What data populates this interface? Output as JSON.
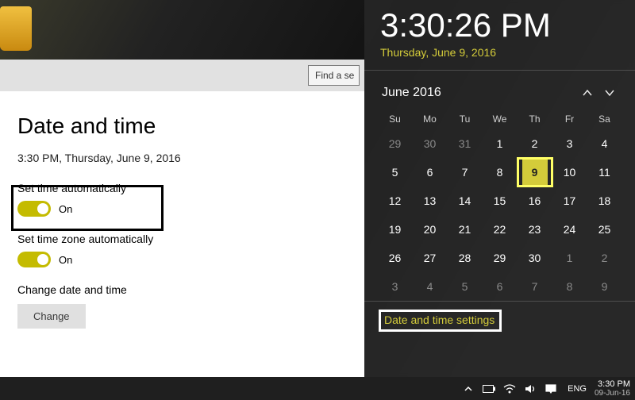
{
  "ribbon": {
    "search_placeholder": "Find a se"
  },
  "settings": {
    "title": "Date and time",
    "current": "3:30 PM, Thursday, June 9, 2016",
    "auto_time_label": "Set time automatically",
    "auto_time_state": "On",
    "auto_tz_label": "Set time zone automatically",
    "auto_tz_state": "On",
    "change_label": "Change date and time",
    "change_button": "Change"
  },
  "flyout": {
    "time": "3:30:26 PM",
    "date": "Thursday, June 9, 2016",
    "month_label": "June 2016",
    "dow": [
      "Su",
      "Mo",
      "Tu",
      "We",
      "Th",
      "Fr",
      "Sa"
    ],
    "weeks": [
      [
        {
          "n": 29,
          "dim": true
        },
        {
          "n": 30,
          "dim": true
        },
        {
          "n": 31,
          "dim": true
        },
        {
          "n": 1
        },
        {
          "n": 2
        },
        {
          "n": 3
        },
        {
          "n": 4
        }
      ],
      [
        {
          "n": 5
        },
        {
          "n": 6
        },
        {
          "n": 7
        },
        {
          "n": 8
        },
        {
          "n": 9,
          "today": true
        },
        {
          "n": 10
        },
        {
          "n": 11
        }
      ],
      [
        {
          "n": 12
        },
        {
          "n": 13
        },
        {
          "n": 14
        },
        {
          "n": 15
        },
        {
          "n": 16
        },
        {
          "n": 17
        },
        {
          "n": 18
        }
      ],
      [
        {
          "n": 19
        },
        {
          "n": 20
        },
        {
          "n": 21
        },
        {
          "n": 22
        },
        {
          "n": 23
        },
        {
          "n": 24
        },
        {
          "n": 25
        }
      ],
      [
        {
          "n": 26
        },
        {
          "n": 27
        },
        {
          "n": 28
        },
        {
          "n": 29
        },
        {
          "n": 30
        },
        {
          "n": 1,
          "dim": true
        },
        {
          "n": 2,
          "dim": true
        }
      ],
      [
        {
          "n": 3,
          "dim": true
        },
        {
          "n": 4,
          "dim": true
        },
        {
          "n": 5,
          "dim": true
        },
        {
          "n": 6,
          "dim": true
        },
        {
          "n": 7,
          "dim": true
        },
        {
          "n": 8,
          "dim": true
        },
        {
          "n": 9,
          "dim": true
        }
      ]
    ],
    "link": "Date and time settings"
  },
  "taskbar": {
    "lang": "ENG",
    "time": "3:30 PM",
    "date": "09-Jun-16"
  }
}
